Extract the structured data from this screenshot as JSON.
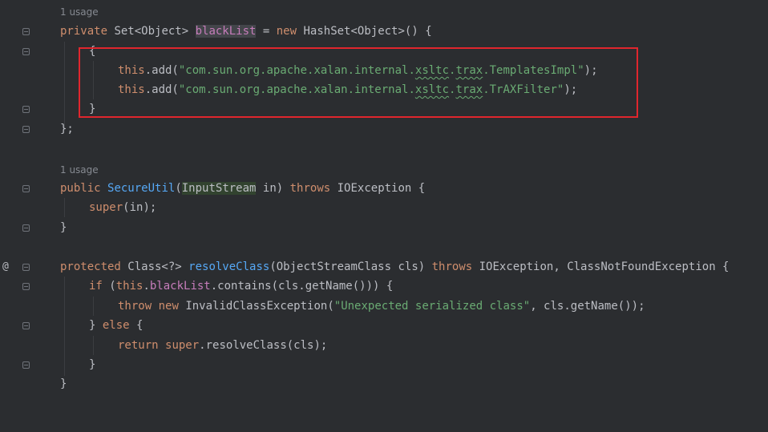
{
  "usage_hints": [
    "1 usage",
    "1 usage"
  ],
  "lines": {
    "l1": [
      "private",
      " Set<Object> ",
      "blackList",
      " = ",
      "new",
      " HashSet<Object>() {"
    ],
    "l2": [
      "{"
    ],
    "l3": [
      "this",
      ".add(",
      "\"com.sun.org.apache.xalan.internal.",
      "xsltc",
      ".",
      "trax",
      ".TemplatesImpl\"",
      ");"
    ],
    "l4": [
      "this",
      ".add(",
      "\"com.sun.org.apache.xalan.internal.",
      "xsltc",
      ".",
      "trax",
      ".TrAXFilter\"",
      ");"
    ],
    "l5": [
      "}"
    ],
    "l6": [
      "};"
    ],
    "l7": [
      "public",
      " ",
      "SecureUtil",
      "(",
      "InputStream",
      " in) ",
      "throws",
      " IOException {"
    ],
    "l8": [
      "super",
      "(in);"
    ],
    "l9": [
      "}"
    ],
    "l10": [
      "protected",
      " Class<?> ",
      "resolveClass",
      "(ObjectStreamClass cls) ",
      "throws",
      " IOException, ClassNotFoundException {"
    ],
    "l11": [
      "if",
      " (",
      "this",
      ".",
      "blackList",
      ".contains(cls.getName())) {"
    ],
    "l12": [
      "throw",
      " ",
      "new",
      " InvalidClassException(",
      "\"Unexpected serialized class\"",
      ", cls.getName());"
    ],
    "l13": [
      "}",
      " ",
      "else",
      " {"
    ],
    "l14": [
      "return",
      " ",
      "super",
      ".resolveClass(cls);"
    ],
    "l15": [
      "}"
    ],
    "l16": [
      "}"
    ]
  },
  "gutter_icons": {
    "override": "@"
  },
  "colors": {
    "background": "#2b2d30",
    "keyword": "#cf8e6d",
    "method": "#56a8f5",
    "field": "#c77dbb",
    "string": "#6aab73",
    "highlight_box": "#e0262d"
  }
}
